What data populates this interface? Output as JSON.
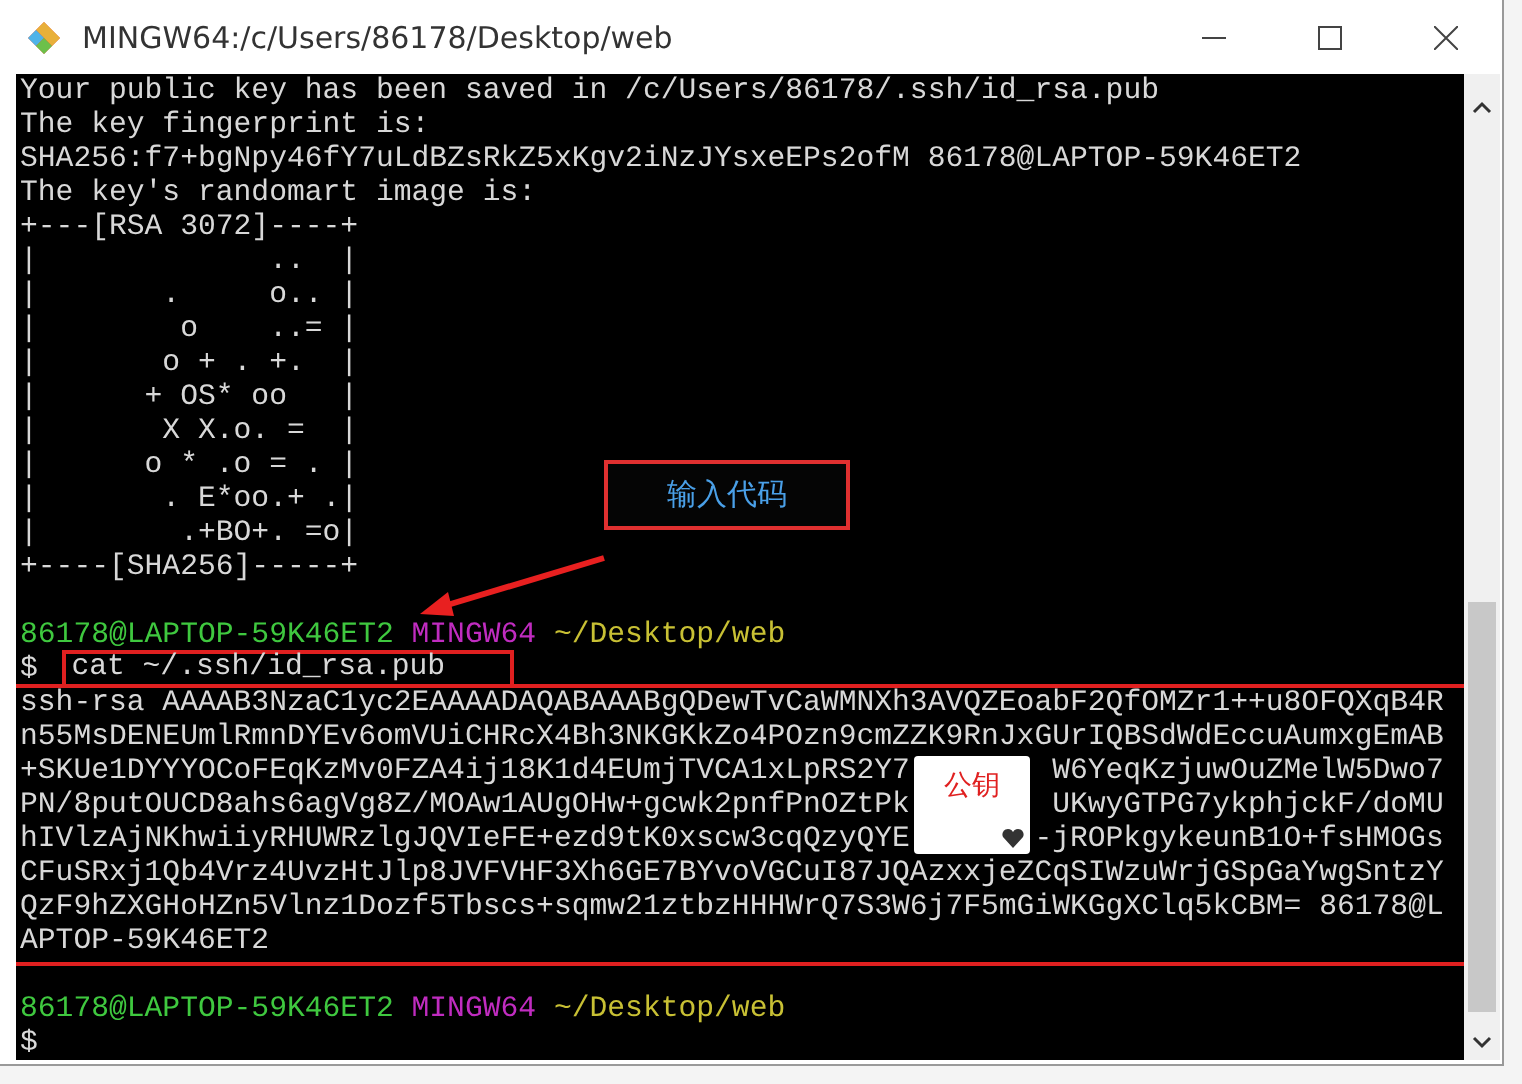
{
  "window": {
    "title": "MINGW64:/c/Users/86178/Desktop/web"
  },
  "terminal": {
    "lines": [
      {
        "kind": "plain",
        "text": "Your public key has been saved in /c/Users/86178/.ssh/id_rsa.pub"
      },
      {
        "kind": "plain",
        "text": "The key fingerprint is:"
      },
      {
        "kind": "plain",
        "text": "SHA256:f7+bgNpy46fY7uLdBZsRkZ5xKgv2iNzJYsxeEPs2ofM 86178@LAPTOP-59K46ET2"
      },
      {
        "kind": "plain",
        "text": "The key's randomart image is:"
      },
      {
        "kind": "plain",
        "text": "+---[RSA 3072]----+"
      },
      {
        "kind": "plain",
        "text": "|             ..  |"
      },
      {
        "kind": "plain",
        "text": "|       .     o.. |"
      },
      {
        "kind": "plain",
        "text": "|        o    ..= |"
      },
      {
        "kind": "plain",
        "text": "|       o + . +.  |"
      },
      {
        "kind": "plain",
        "text": "|      + OS* oo   |"
      },
      {
        "kind": "plain",
        "text": "|       X X.o. =  |"
      },
      {
        "kind": "plain",
        "text": "|      o * .o = . |"
      },
      {
        "kind": "plain",
        "text": "|       . E*oo.+ .|"
      },
      {
        "kind": "plain",
        "text": "|        .+BO+. =o|"
      },
      {
        "kind": "plain",
        "text": "+----[SHA256]-----+"
      },
      {
        "kind": "blank"
      },
      {
        "kind": "prompt",
        "user_host": "86178@LAPTOP-59K46ET2",
        "shell": "MINGW64",
        "path": "~/Desktop/web"
      },
      {
        "kind": "command",
        "symbol": "$",
        "text": "cat ~/.ssh/id_rsa.pub"
      },
      {
        "kind": "plain",
        "text": "ssh-rsa AAAAB3NzaC1yc2EAAAADAQABAAABgQDewTvCaWMNXh3AVQZEoabF2QfOMZr1++u8OFQXqB4R"
      },
      {
        "kind": "plain",
        "text": "n55MsDENEUmlRmnDYEv6omVUiCHRcX4Bh3NKGKkZo4POzn9cmZZK9RnJxGUrIQBSdWdEccuAumxgEmAB"
      },
      {
        "kind": "split",
        "left": "+SKUe1DYYYOCoFEqKzMv0FZA4ij18K1d4EUmjTVCA1xLpRS2Y7",
        "right": "W6YeqKzjuwOuZMelW5Dwo7"
      },
      {
        "kind": "split",
        "left": "PN/8putOUCD8ahs6agVg8Z/MOAw1AUgOHw+gcwk2pnfPnOZtPk",
        "right": "UKwyGTPG7ykphjckF/doMU"
      },
      {
        "kind": "split",
        "left": "hIVlzAjNKhwiiyRHUWRzlgJQVIeFE+ezd9tK0xscw3cqQzyQYE",
        "right": "-jROPkgykeunB1O+fsHMOGs"
      },
      {
        "kind": "plain",
        "text": "CFuSRxj1Qb4Vrz4UvzHtJlp8JVFVHF3Xh6GE7BYvoVGCuI87JQAzxxjeZCqSIWzuWrjGSpGaYwgSntzY"
      },
      {
        "kind": "plain",
        "text": "QzF9hZXGHoHZn5Vlnz1Dozf5Tbscs+sqmw21ztbzHHHWrQ7S3W6j7F5mGiWKGgXClq5kCBM= 86178@L"
      },
      {
        "kind": "plain",
        "text": "APTOP-59K46ET2"
      },
      {
        "kind": "blank"
      },
      {
        "kind": "prompt",
        "user_host": "86178@LAPTOP-59K46ET2",
        "shell": "MINGW64",
        "path": "~/Desktop/web"
      },
      {
        "kind": "input",
        "symbol": "$"
      }
    ]
  },
  "annotations": {
    "code_label": "输入代码",
    "key_label": "公钥"
  }
}
